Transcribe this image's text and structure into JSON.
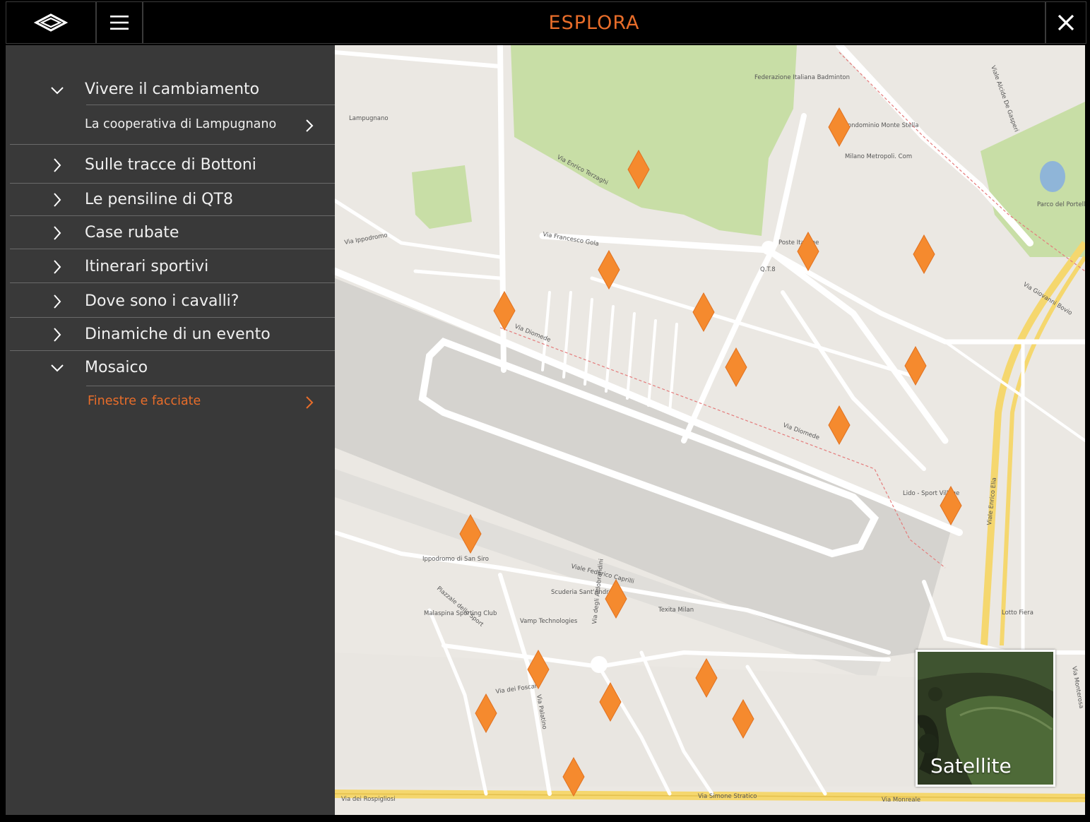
{
  "header": {
    "title": "ESPLORA",
    "accent": "#e86d2a"
  },
  "sidebar": {
    "items": [
      {
        "label": "Vivere il cambiamento",
        "state": "expanded"
      },
      {
        "label": "La cooperativa di Lampugnano",
        "type": "sub"
      },
      {
        "label": "Sulle tracce di Bottoni",
        "state": "collapsed"
      },
      {
        "label": "Le pensiline di QT8",
        "state": "collapsed"
      },
      {
        "label": "Case rubate",
        "state": "collapsed"
      },
      {
        "label": "Itinerari sportivi",
        "state": "collapsed"
      },
      {
        "label": "Dove sono i cavalli?",
        "state": "collapsed"
      },
      {
        "label": "Dinamiche di un evento",
        "state": "collapsed"
      },
      {
        "label": "Mosaico",
        "state": "expanded"
      },
      {
        "label": "Finestre e facciate",
        "type": "sub",
        "active": true
      }
    ]
  },
  "map": {
    "satellite_label": "Satellite",
    "marker_color": "#f58a2e",
    "labels": [
      "Via Enrico Terzaghi",
      "Via Diomede",
      "Viale Federico Caprilli",
      "Via dei Rospigliosi",
      "Via Simone Stratico",
      "Via Monreale",
      "Viale Alcide De Gasperi",
      "Viale Enrico Elia",
      "Via Francesco Gola",
      "Lampugnano",
      "Q.T.8",
      "Lotto Fiera",
      "Via Ippodromo",
      "Piazzale dello Sport",
      "Malaspina Sporting Club",
      "Ippodromo di San Siro",
      "Lido - Sport Village",
      "Condominio Monte Stella",
      "Federazione Italiana Badminton",
      "Milano Metropoli. Com",
      "Poste Italiane",
      "Parco del Portello",
      "Via Palatino",
      "Via dei Foscari",
      "Via degli Aldobrandini",
      "Scuderia Sant'Andrea",
      "Vamp Technologies",
      "Texita Milan",
      "Via Monterosa",
      "Via Giovanni Bovio",
      "Via Diomede"
    ]
  }
}
